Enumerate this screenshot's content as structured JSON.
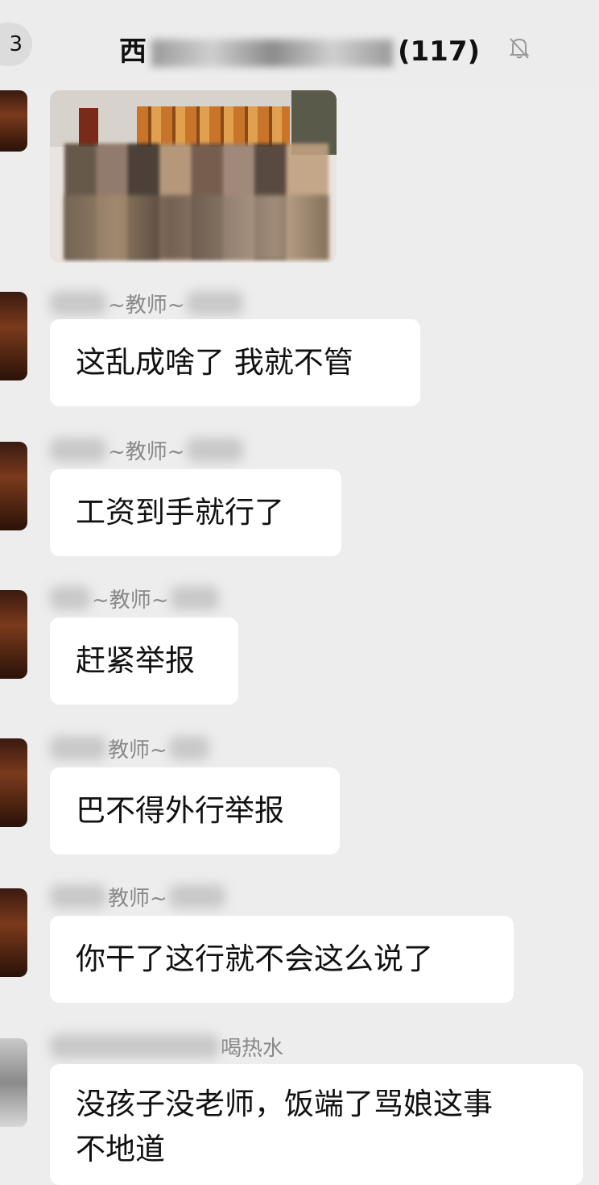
{
  "header": {
    "back_badge": "3",
    "title_prefix": "西",
    "title_suffix": "(117)",
    "mute_icon": "bell-off-icon"
  },
  "messages": [
    {
      "sender_tag": "~教师~",
      "text": "这乱成啥了 我就不管"
    },
    {
      "sender_tag": "~教师~",
      "text": "工资到手就行了"
    },
    {
      "sender_tag": "~教师~",
      "text": "赶紧举报"
    },
    {
      "sender_tag": "教师~",
      "text": "巴不得外行举报"
    },
    {
      "sender_tag": "教师~",
      "text": "你干了这行就不会这么说了"
    },
    {
      "sender_tag": "喝热水",
      "text_line1": "没孩子没老师，饭端了骂娘这事",
      "text_line2": "不地道"
    }
  ]
}
